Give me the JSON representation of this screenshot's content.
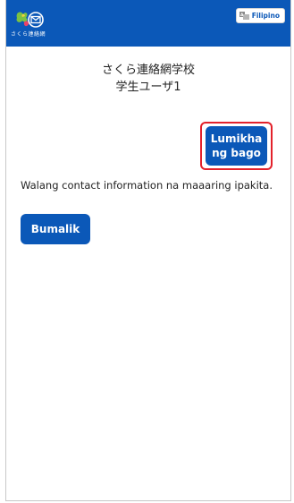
{
  "header": {
    "logo_text": "さくら連絡網",
    "language_label": "Filipino",
    "brand_color": "#0b58b8",
    "logo_icon": "sakura-renrakumou-logo-icon",
    "language_icon": "language-translate-icon"
  },
  "main": {
    "school_name": "さくら連絡網学校",
    "user_name": "学生ユーザ1",
    "create_button_label": "Lumikha ng bago",
    "empty_message": "Walang contact information na maaaring ipakita.",
    "back_button_label": "Bumalik",
    "highlight_color": "#e3212b"
  }
}
